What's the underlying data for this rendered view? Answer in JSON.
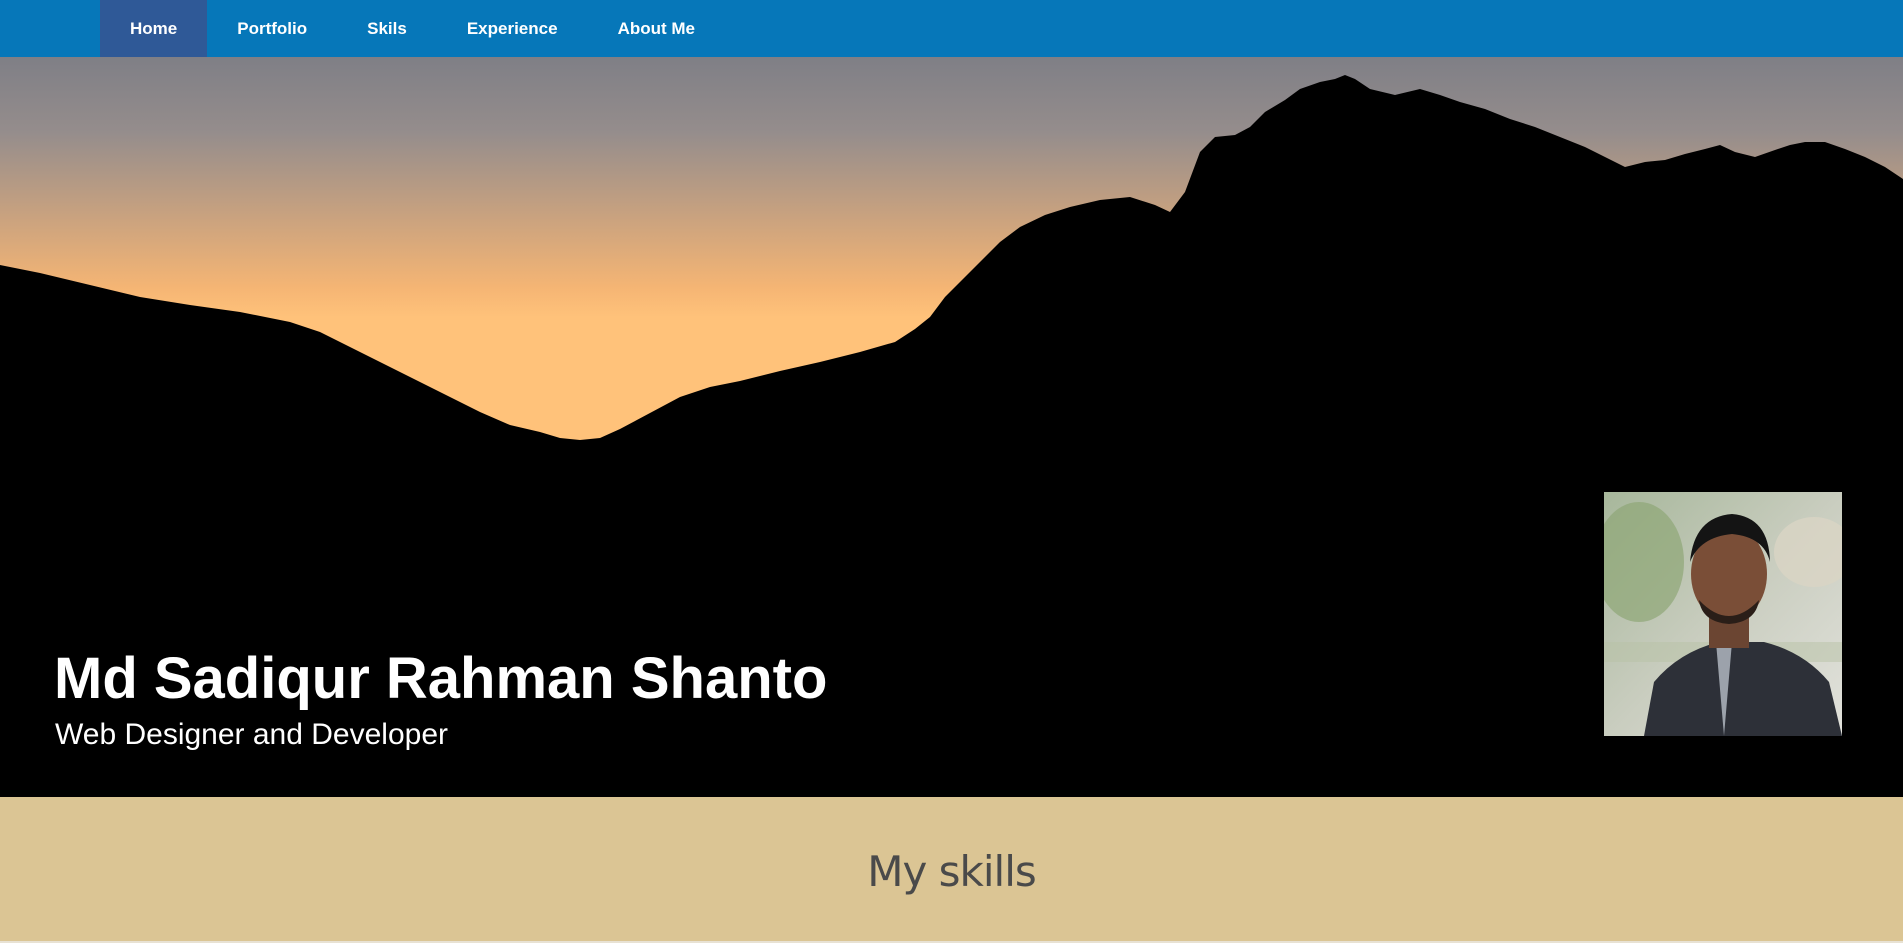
{
  "nav": {
    "items": [
      {
        "label": "Home",
        "active": true
      },
      {
        "label": "Portfolio",
        "active": false
      },
      {
        "label": "Skils",
        "active": false
      },
      {
        "label": "Experience",
        "active": false
      },
      {
        "label": "About Me",
        "active": false
      }
    ]
  },
  "hero": {
    "name": "Md Sadiqur Rahman Shanto",
    "role": "Web Designer and Developer"
  },
  "skills": {
    "title": "My skills"
  },
  "colors": {
    "nav_bg": "#0677b9",
    "nav_active": "#2f5997",
    "hero_bg": "#000000",
    "skills_bg": "#dbc594"
  }
}
